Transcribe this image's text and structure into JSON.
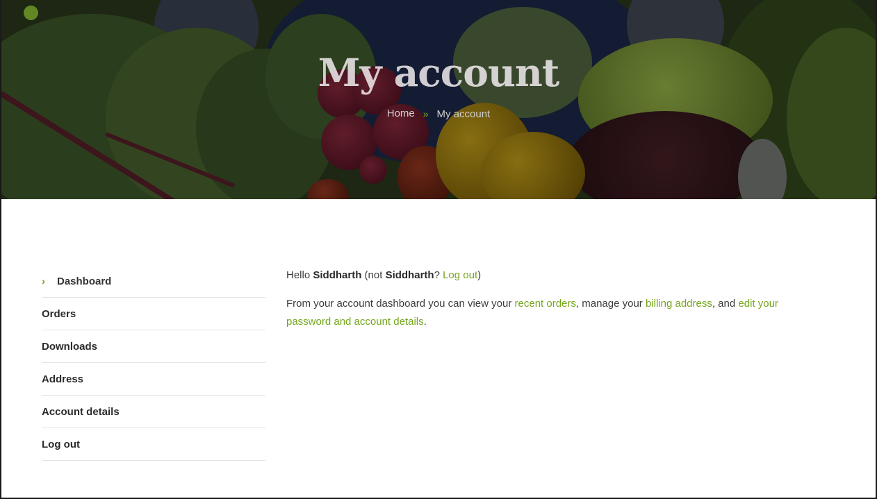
{
  "hero": {
    "title": "My account",
    "breadcrumb": {
      "home": "Home",
      "separator": "»",
      "current": "My account"
    }
  },
  "sidebar": {
    "items": [
      {
        "label": "Dashboard",
        "active": true,
        "chevron": "›"
      },
      {
        "label": "Orders"
      },
      {
        "label": "Downloads"
      },
      {
        "label": "Address"
      },
      {
        "label": "Account details"
      },
      {
        "label": "Log out"
      }
    ]
  },
  "main": {
    "greeting": {
      "hello": "Hello",
      "username": "Siddharth",
      "not_prefix": "(not",
      "not_username": "Siddharth",
      "question": "?",
      "logout_link": "Log out",
      "close_paren": ")"
    },
    "description": {
      "part1": "From your account dashboard you can view your",
      "recent_orders_link": "recent orders",
      "part2": ", manage your",
      "billing_address_link": "billing address",
      "part3": ", and",
      "edit_account_link": "edit your password and account details",
      "part4": "."
    }
  },
  "colors": {
    "accent": "#74a51c",
    "text": "#3c3c3c",
    "divider": "#e3e3e3"
  }
}
